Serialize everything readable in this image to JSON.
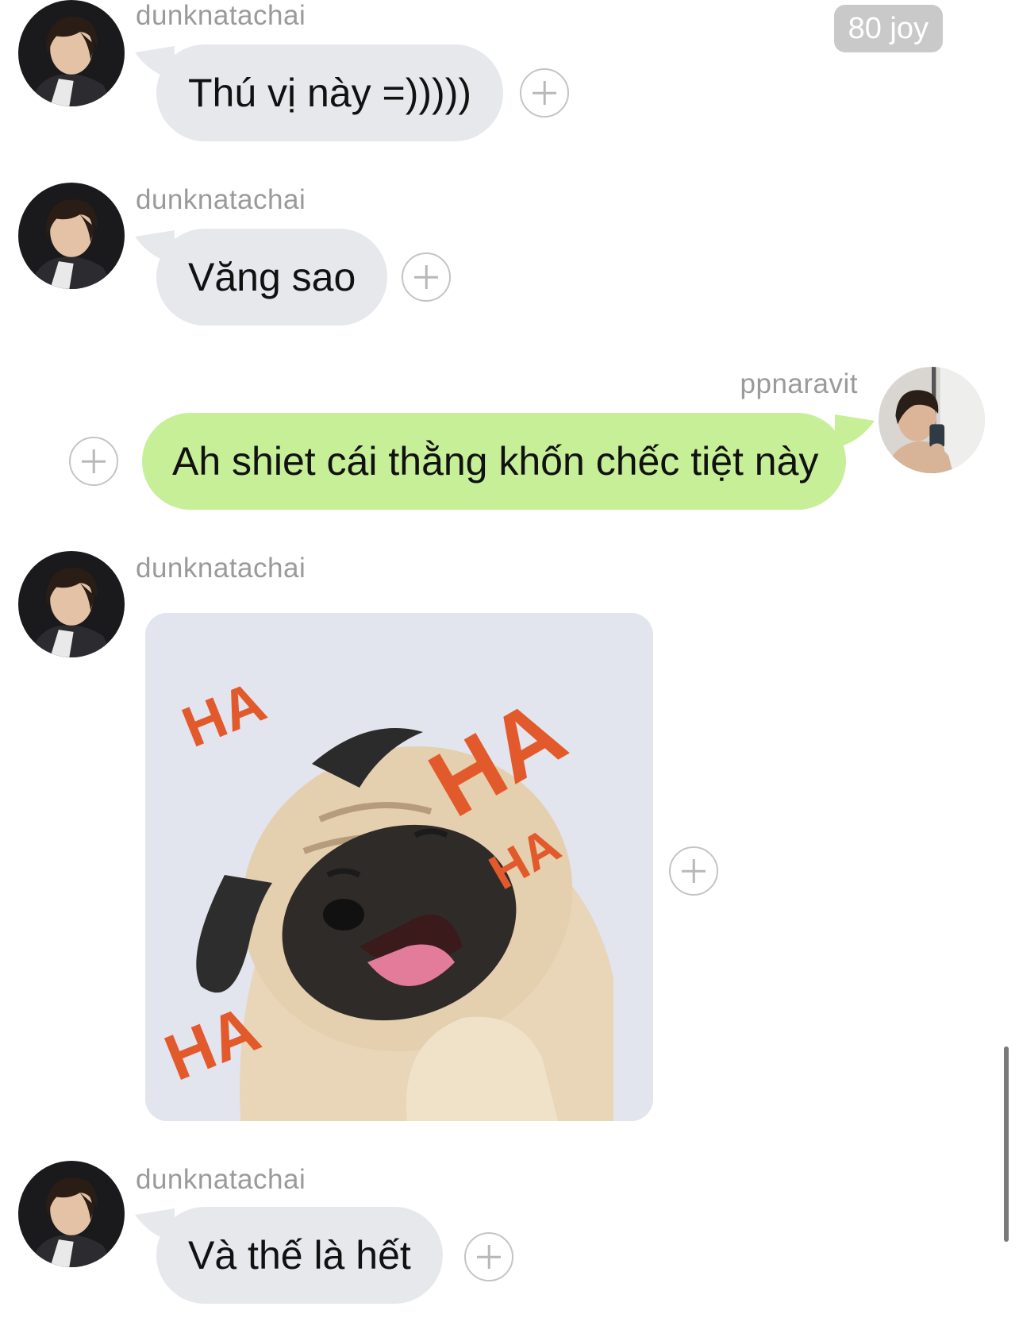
{
  "badge": {
    "label": "80 joy"
  },
  "messages": [
    {
      "sender": "dunknatachai",
      "text": "Thú vị này =)))))"
    },
    {
      "sender": "dunknatachai",
      "text": "Văng sao"
    },
    {
      "sender": "ppnaravit",
      "text": "Ah shiet cái thằng khốn chếc tiệt này"
    },
    {
      "sender": "dunknatachai",
      "sticker": {
        "text_large": "HA",
        "text_small": "HA"
      }
    },
    {
      "sender": "dunknatachai",
      "text": "Và thế là hết"
    }
  ],
  "colors": {
    "incoming_bubble": "#e6e8ec",
    "outgoing_bubble": "#c7ef98",
    "sender_name": "#9a9a9a",
    "sticker_text": "#e25a2c"
  },
  "icons": [
    "avatar-dunknatachai",
    "avatar-ppnaravit",
    "add-reaction-icon"
  ]
}
